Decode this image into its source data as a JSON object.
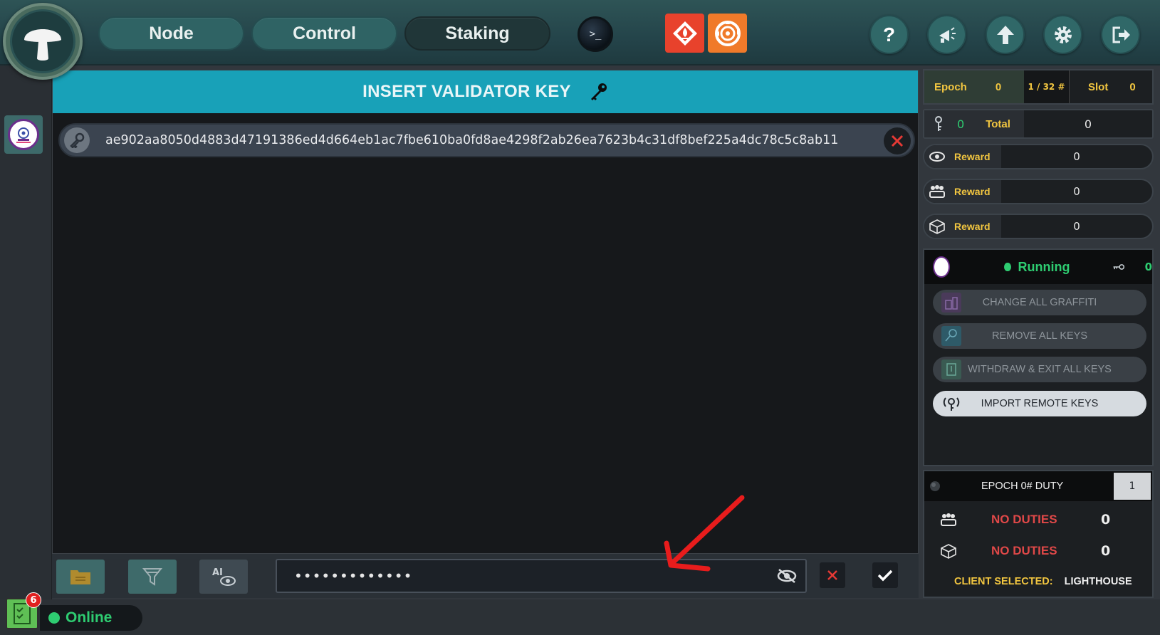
{
  "nav": {
    "node_label": "Node",
    "control_label": "Control",
    "staking_label": "Staking",
    "terminal_label": ">_"
  },
  "header_icons": [
    "prometheus-icon",
    "grafana-icon",
    "help-icon",
    "announcement-icon",
    "update-icon",
    "gear-icon",
    "logout-icon"
  ],
  "panel": {
    "title": "INSERT VALIDATOR KEY",
    "key_value": "ae902aa8050d4883d47191386ed4d664eb1ac7fbe610ba0fd8ae4298f2ab26ea7623b4c31df8bef225a4dc78c5c8ab11"
  },
  "password": {
    "value": "•••••••••••••"
  },
  "epoch": {
    "epoch_label": "Epoch",
    "epoch_value": "0",
    "progress": "1 / 32 #",
    "slot_label": "Slot",
    "slot_value": "0"
  },
  "keys_total": {
    "keys_count": "0",
    "total_label": "Total",
    "total_value": "0"
  },
  "rewards": [
    {
      "icon": "eye-icon",
      "label": "Reward",
      "value": "0"
    },
    {
      "icon": "committee-icon",
      "label": "Reward",
      "value": "0"
    },
    {
      "icon": "cube-icon",
      "label": "Reward",
      "value": "0"
    }
  ],
  "client": {
    "status": "Running",
    "key_count": "0",
    "actions": [
      {
        "label": "CHANGE ALL GRAFFITI",
        "enabled": false
      },
      {
        "label": "REMOVE ALL KEYS",
        "enabled": false
      },
      {
        "label": "WITHDRAW & EXIT ALL KEYS",
        "enabled": false
      },
      {
        "label": "IMPORT REMOTE KEYS",
        "enabled": true
      }
    ]
  },
  "duty": {
    "title": "EPOCH 0# DUTY",
    "epoch_number": "1",
    "rows": [
      {
        "icon": "committee-icon",
        "label": "NO DUTIES",
        "value": "0"
      },
      {
        "icon": "cube-icon",
        "label": "NO DUTIES",
        "value": "0"
      }
    ],
    "client_selected_label": "CLIENT SELECTED:",
    "client_selected_value": "LIGHTHOUSE"
  },
  "status": {
    "tasks_count": "6",
    "online_label": "Online"
  },
  "colors": {
    "accent_header": "#18a1b8",
    "running_green": "#2ecc71",
    "reward_gold": "#f2c640",
    "no_duty_red": "#e04848",
    "annotation_arrow": "#e81c1c"
  }
}
